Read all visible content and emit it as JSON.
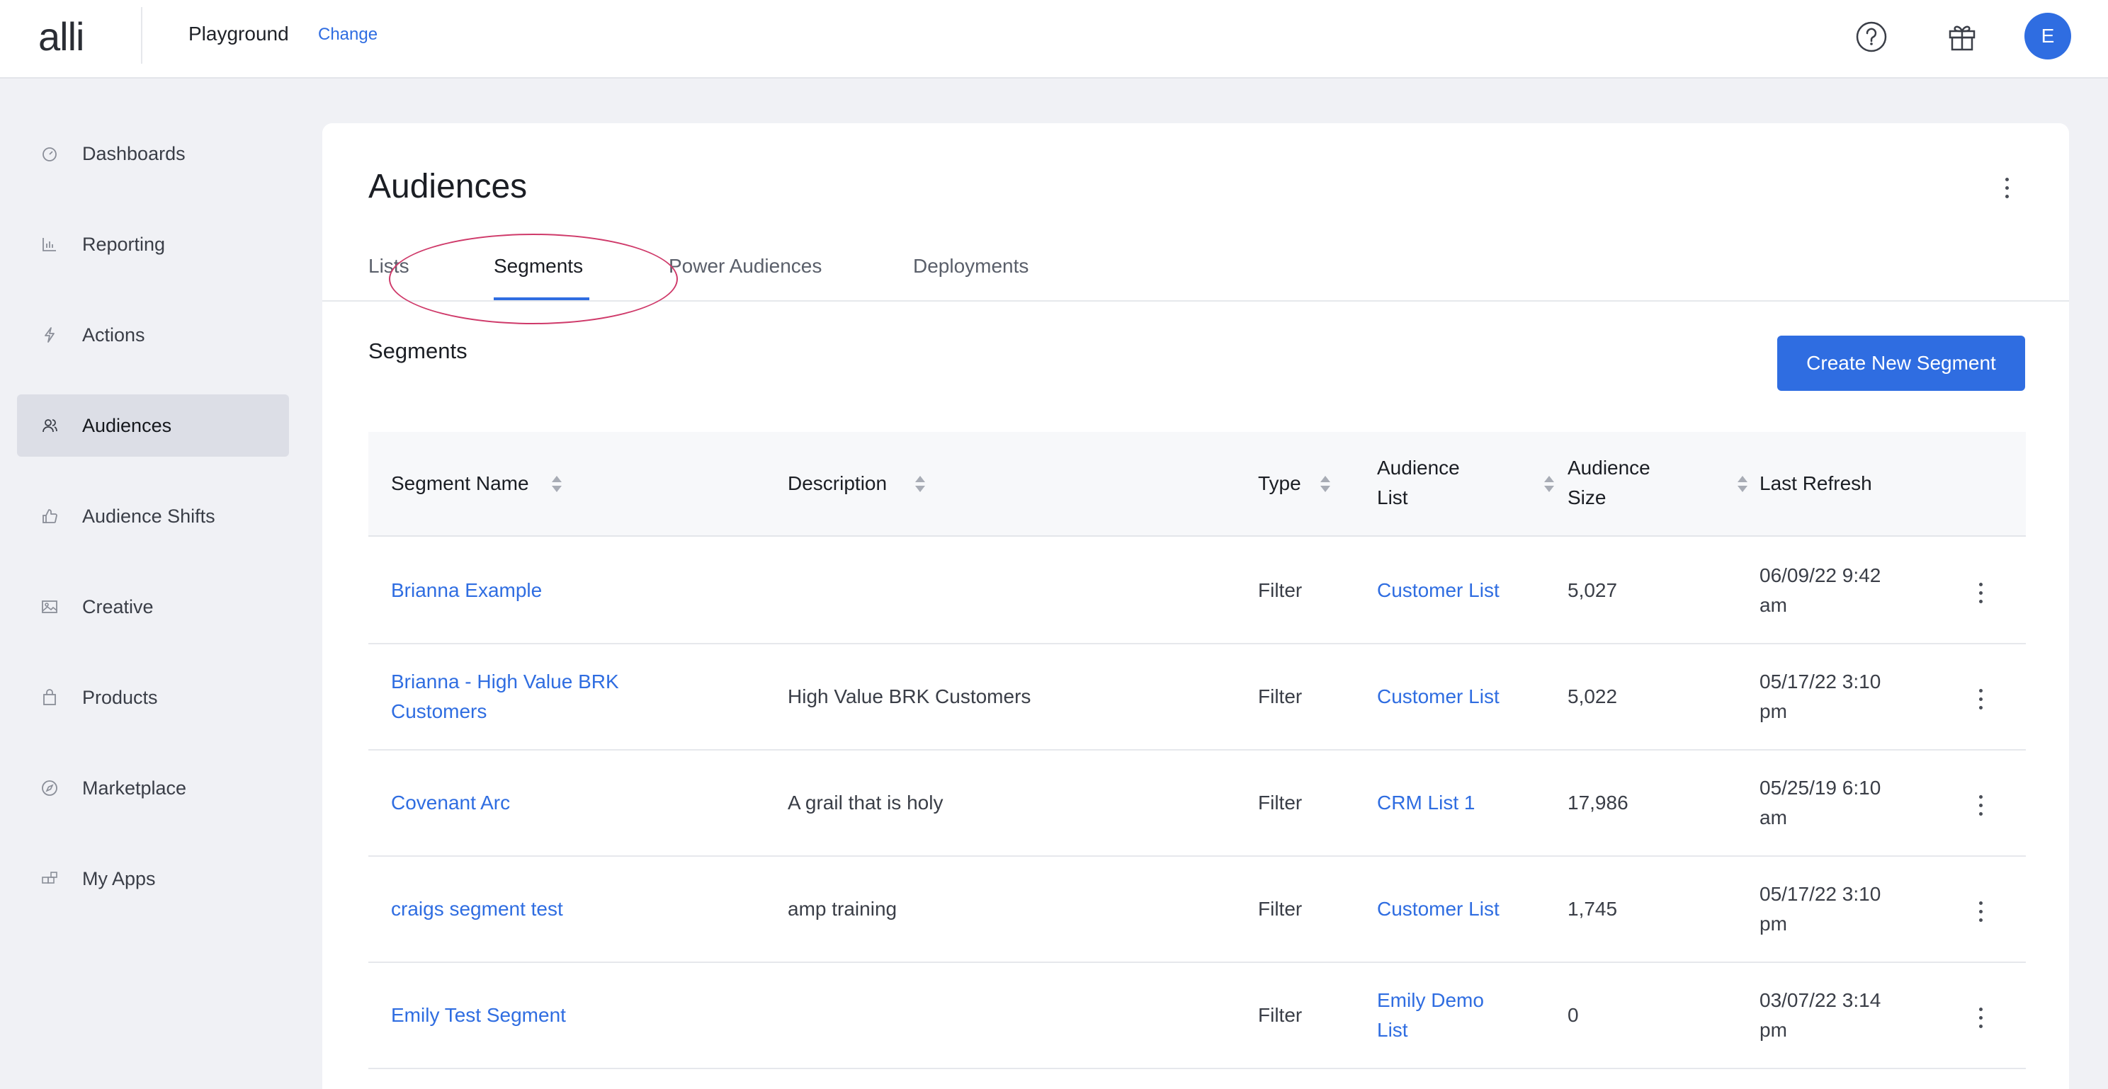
{
  "header": {
    "logo": "alli",
    "workspace": "Playground",
    "change_label": "Change",
    "help_icon": "help-circle-icon",
    "gift_icon": "gift-icon",
    "avatar_initial": "E",
    "avatar_color": "#2f6de1"
  },
  "sidebar": {
    "items": [
      {
        "label": "Dashboards",
        "icon": "dashboard-icon",
        "active": false
      },
      {
        "label": "Reporting",
        "icon": "bar-chart-icon",
        "active": false
      },
      {
        "label": "Actions",
        "icon": "lightning-icon",
        "active": false
      },
      {
        "label": "Audiences",
        "icon": "users-icon",
        "active": true
      },
      {
        "label": "Audience Shifts",
        "icon": "thumbs-up-icon",
        "active": false
      },
      {
        "label": "Creative",
        "icon": "image-icon",
        "active": false
      },
      {
        "label": "Products",
        "icon": "bag-icon",
        "active": false
      },
      {
        "label": "Marketplace",
        "icon": "compass-icon",
        "active": false
      },
      {
        "label": "My Apps",
        "icon": "apps-icon",
        "active": false
      }
    ]
  },
  "page": {
    "title": "Audiences",
    "tabs": [
      {
        "label": "Lists",
        "active": false
      },
      {
        "label": "Segments",
        "active": true
      },
      {
        "label": "Power Audiences",
        "active": false
      },
      {
        "label": "Deployments",
        "active": false
      }
    ],
    "section_title": "Segments",
    "create_button": "Create New Segment",
    "accent_color": "#2f6de1",
    "annotation_color": "#cf3a6a"
  },
  "table": {
    "columns": {
      "name": "Segment Name",
      "description": "Description",
      "type": "Type",
      "audience_list_1": "Audience",
      "audience_list_2": "List",
      "audience_size_1": "Audience",
      "audience_size_2": "Size",
      "last_refresh": "Last Refresh"
    },
    "rows": [
      {
        "name_1": "Brianna Example",
        "name_2": "",
        "description": "",
        "type": "Filter",
        "list_1": "Customer List",
        "list_2": "",
        "size": "5,027",
        "refresh_1": "06/09/22 9:42",
        "refresh_2": "am"
      },
      {
        "name_1": "Brianna - High Value BRK",
        "name_2": "Customers",
        "description": "High Value BRK Customers",
        "type": "Filter",
        "list_1": "Customer List",
        "list_2": "",
        "size": "5,022",
        "refresh_1": "05/17/22 3:10",
        "refresh_2": "pm"
      },
      {
        "name_1": "Covenant Arc",
        "name_2": "",
        "description": "A grail that is holy",
        "type": "Filter",
        "list_1": "CRM List 1",
        "list_2": "",
        "size": "17,986",
        "refresh_1": "05/25/19 6:10",
        "refresh_2": "am"
      },
      {
        "name_1": "craigs segment test",
        "name_2": "",
        "description": "amp training",
        "type": "Filter",
        "list_1": "Customer List",
        "list_2": "",
        "size": "1,745",
        "refresh_1": "05/17/22 3:10",
        "refresh_2": "pm"
      },
      {
        "name_1": "Emily Test Segment",
        "name_2": "",
        "description": "",
        "type": "Filter",
        "list_1": "Emily Demo",
        "list_2": "List",
        "size": "0",
        "refresh_1": "03/07/22 3:14",
        "refresh_2": "pm"
      }
    ]
  }
}
